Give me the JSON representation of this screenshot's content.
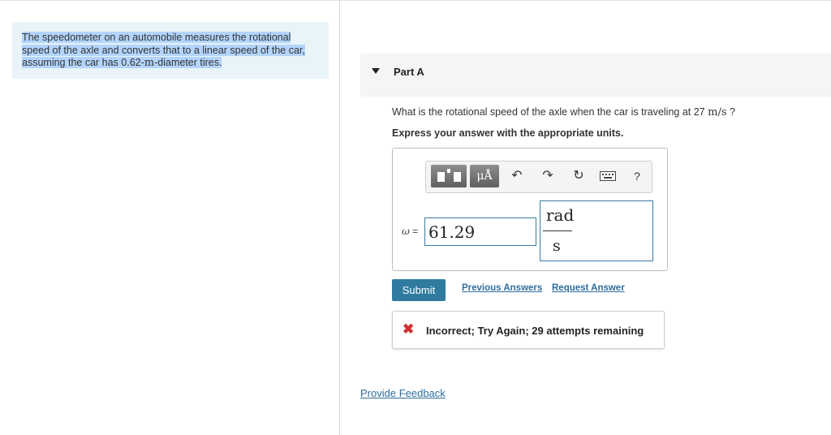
{
  "problem": {
    "line1": "The speedometer on an automobile measures the rotational",
    "line2": "speed of the axle and converts that to a linear speed of the car,",
    "line3_pre": "assuming the car has 0.62-",
    "line3_unit": "m",
    "line3_post": "-diameter tires."
  },
  "part": {
    "title": "Part A"
  },
  "question": {
    "text_pre": "What is the rotational speed of the axle when the car is traveling at 27 ",
    "unit": "m/s",
    "text_post": " ?"
  },
  "instruction": "Express your answer with the appropriate units.",
  "toolbar": {
    "units_label": "μÅ",
    "undo_icon": "↶",
    "redo_icon": "↷",
    "reset_icon": "↻",
    "help_label": "?"
  },
  "answer": {
    "variable": "ω",
    "equals": " =",
    "value": "61.29",
    "unit_numerator": "rad",
    "unit_denominator": "s"
  },
  "actions": {
    "submit_label": "Submit",
    "previous_answers_label": "Previous Answers",
    "request_answer_label": "Request Answer"
  },
  "feedback": {
    "icon": "✖",
    "message": "Incorrect; Try Again; 29 attempts remaining",
    "status_color": "#d32f2f"
  },
  "footer": {
    "provide_feedback_label": "Provide Feedback"
  },
  "colors": {
    "accent": "#2f7ba0",
    "link": "#2f6e9e",
    "input_border": "#3a7ca5"
  }
}
